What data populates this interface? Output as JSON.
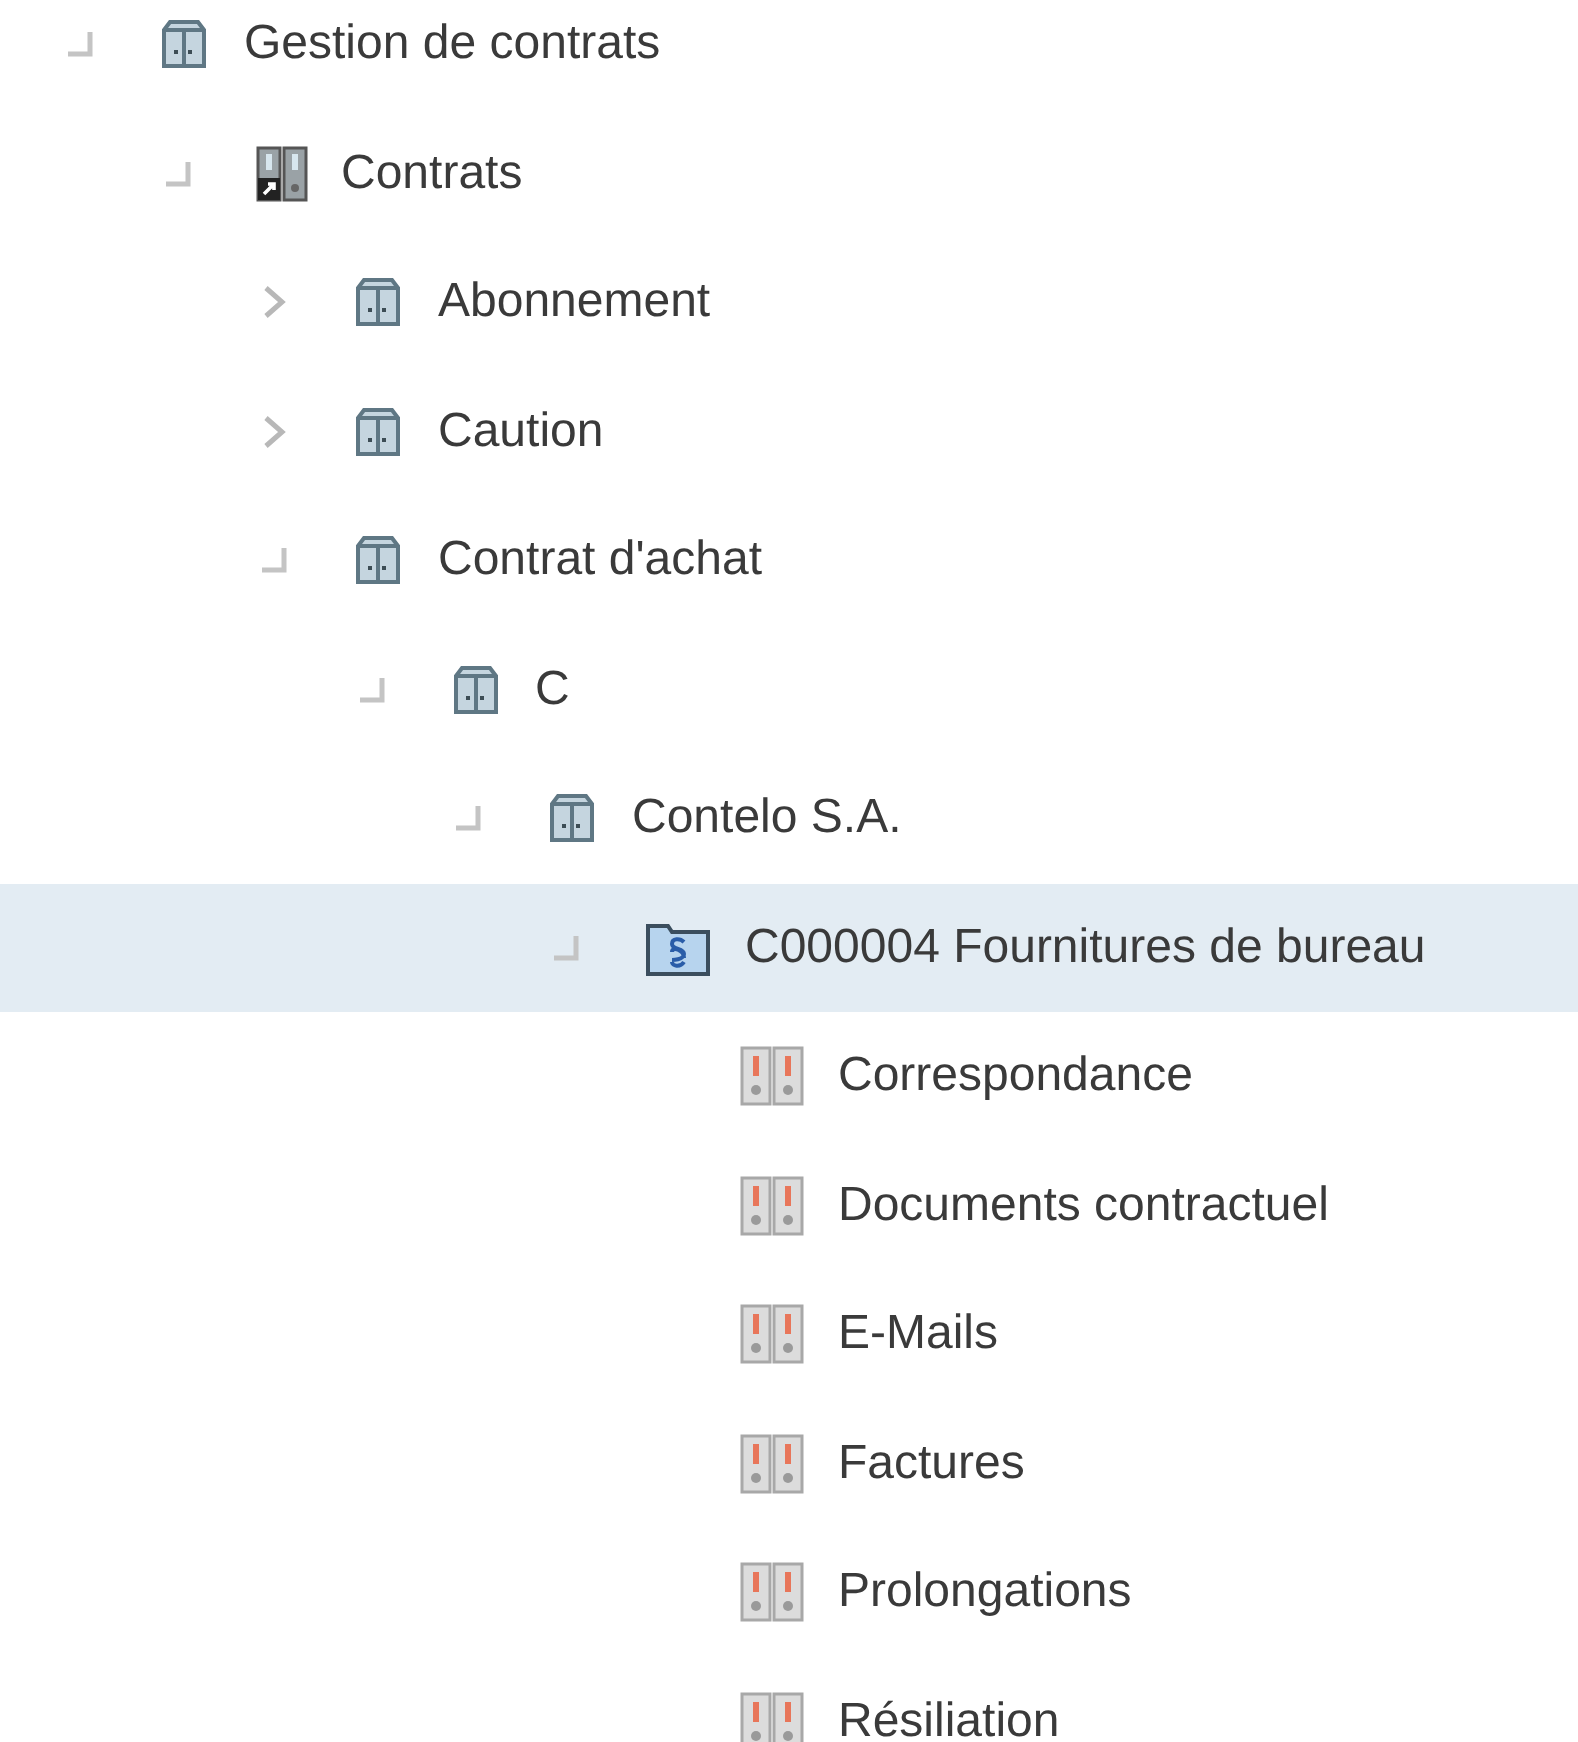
{
  "tree": [
    {
      "label": "Gestion de contrats",
      "kind": "cabinet",
      "expanded": true,
      "selected": false,
      "children": [
        {
          "label": "Contrats",
          "kind": "binder-link",
          "expanded": true,
          "selected": false,
          "children": [
            {
              "label": "Abonnement",
              "kind": "cabinet",
              "expanded": false,
              "selected": false
            },
            {
              "label": "Caution",
              "kind": "cabinet",
              "expanded": false,
              "selected": false
            },
            {
              "label": "Contrat d'achat",
              "kind": "cabinet",
              "expanded": true,
              "selected": false,
              "children": [
                {
                  "label": "C",
                  "kind": "cabinet",
                  "expanded": true,
                  "selected": false,
                  "children": [
                    {
                      "label": "Contelo S.A.",
                      "kind": "cabinet",
                      "expanded": true,
                      "selected": false,
                      "children": [
                        {
                          "label": "C000004 Fournitures de bureau",
                          "kind": "contract",
                          "expanded": true,
                          "selected": true,
                          "children": [
                            {
                              "label": "Correspondance",
                              "kind": "binder",
                              "selected": false
                            },
                            {
                              "label": "Documents contractuel",
                              "kind": "binder",
                              "selected": false
                            },
                            {
                              "label": "E-Mails",
                              "kind": "binder",
                              "selected": false
                            },
                            {
                              "label": "Factures",
                              "kind": "binder",
                              "selected": false
                            },
                            {
                              "label": "Prolongations",
                              "kind": "binder",
                              "selected": false
                            },
                            {
                              "label": "Résiliation",
                              "kind": "binder",
                              "selected": false
                            }
                          ]
                        }
                      ]
                    }
                  ]
                }
              ]
            }
          ]
        }
      ]
    }
  ]
}
